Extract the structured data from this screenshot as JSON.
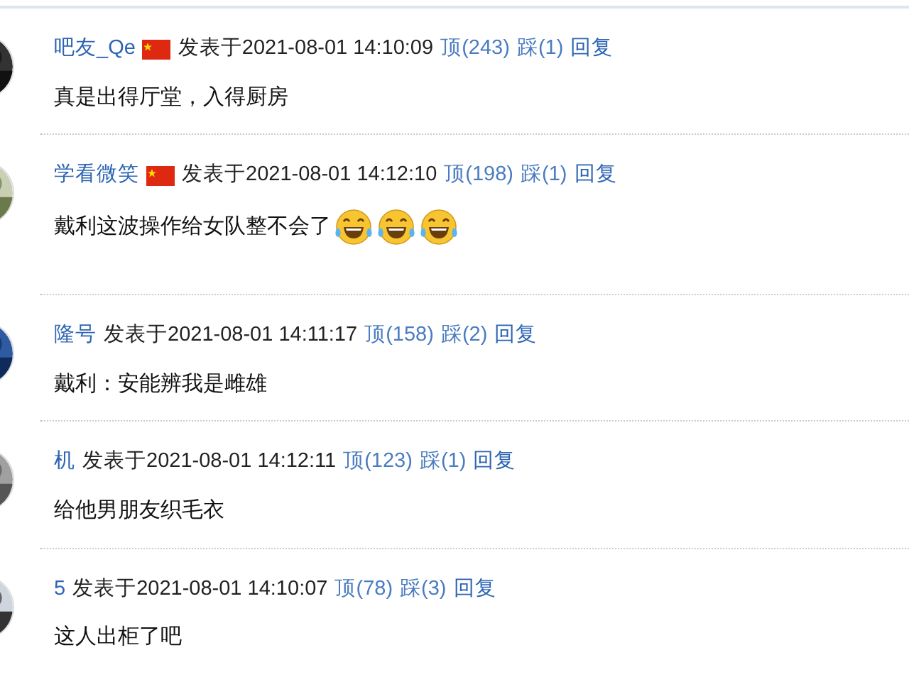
{
  "comments": [
    {
      "user": "吧友_Qe",
      "flag": true,
      "posted": "发表于2021-08-01 14:10:09",
      "up": "顶(243)",
      "down": "踩(1)",
      "reply": "回复",
      "text": "真是出得厅堂，入得厨房"
    },
    {
      "user": "学看微笑",
      "flag": true,
      "posted": "发表于2021-08-01 14:12:10",
      "up": "顶(198)",
      "down": "踩(1)",
      "reply": "回复",
      "text": "戴利这波操作给女队整不会了",
      "emojis": [
        {
          "kind": "laugh"
        },
        {
          "kind": "laugh"
        },
        {
          "kind": "laugh"
        }
      ]
    },
    {
      "user": "隆号",
      "flag": false,
      "posted": "发表于2021-08-01 14:11:17",
      "up": "顶(158)",
      "down": "踩(2)",
      "reply": "回复",
      "text": "戴利：安能辨我是雌雄"
    },
    {
      "user": "机",
      "flag": false,
      "posted": "发表于2021-08-01 14:12:11",
      "up": "顶(123)",
      "down": "踩(1)",
      "reply": "回复",
      "text": "给他男朋友织毛衣"
    },
    {
      "user": "5",
      "flag": false,
      "posted": "发表于2021-08-01 14:10:07",
      "up": "顶(78)",
      "down": "踩(3)",
      "reply": "回复",
      "text": "这人出柜了吧"
    }
  ]
}
